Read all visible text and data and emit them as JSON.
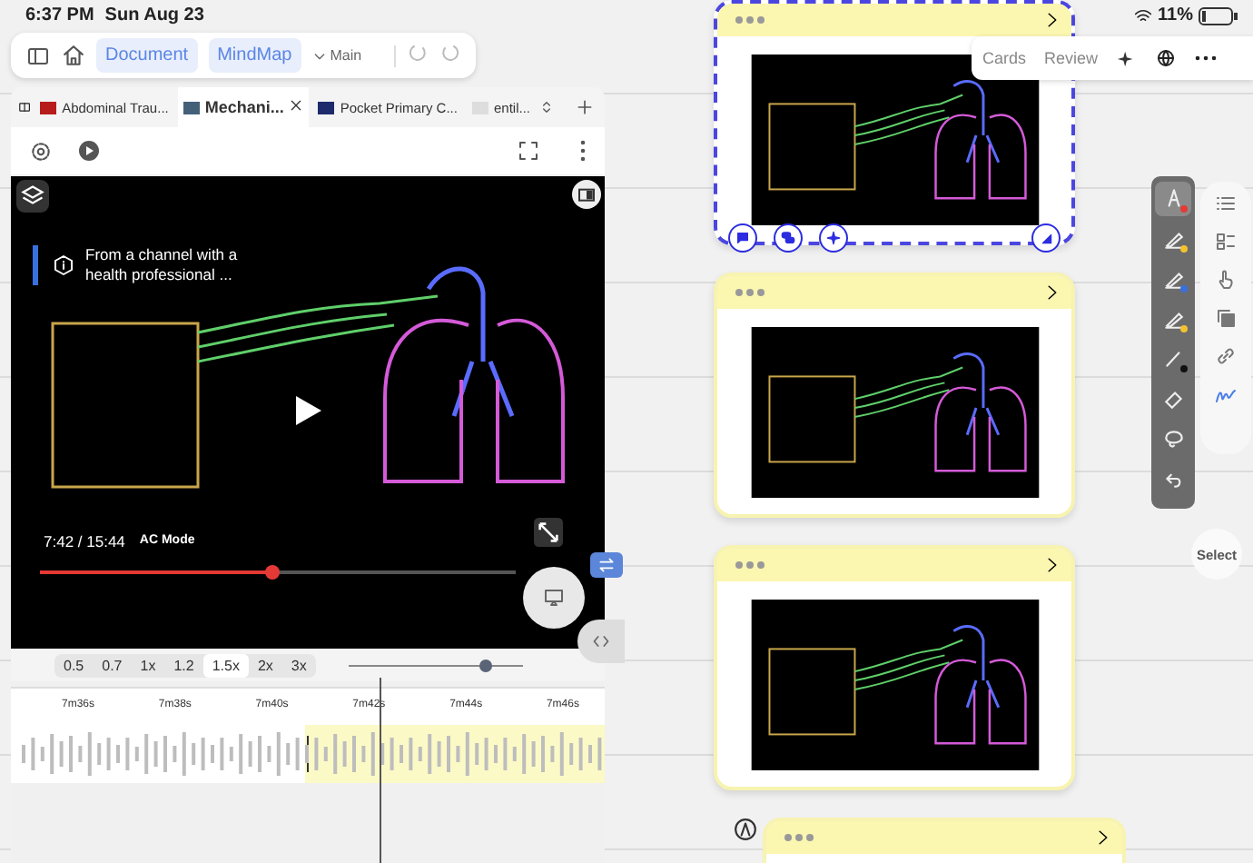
{
  "status_bar": {
    "time": "6:37 PM",
    "date": "Sun Aug 23",
    "battery": "11%"
  },
  "toolbar": {
    "modes": [
      "Document",
      "MindMap"
    ],
    "branch": "Main"
  },
  "browser_tabs": [
    {
      "title": "Abdominal Trau...",
      "selected": false
    },
    {
      "title": "Mechani...",
      "selected": true
    },
    {
      "title": "Pocket Primary C...",
      "selected": false
    },
    {
      "title": "entil...",
      "selected": false
    }
  ],
  "video": {
    "channel_notice": "From a channel with a health professional ...",
    "time": "7:42 / 15:44",
    "chapter": "AC Mode",
    "progress": {
      "level": 0.49
    }
  },
  "speeds": [
    {
      "label": "0.5",
      "selected": false
    },
    {
      "label": "0.7",
      "selected": false
    },
    {
      "label": "1x",
      "selected": false
    },
    {
      "label": "1.2",
      "selected": false
    },
    {
      "label": "1.5x",
      "selected": true
    },
    {
      "label": "2x",
      "selected": false
    },
    {
      "label": "3x",
      "selected": false
    }
  ],
  "zoom_slider": {
    "level": 0.78
  },
  "timeline": {
    "ticks": [
      "7m36s",
      "7m38s",
      "7m40s",
      "7m42s",
      "7m44s",
      "7m46s"
    ]
  },
  "cards": [
    {
      "selected": true
    },
    {
      "selected": false
    },
    {
      "selected": false
    }
  ],
  "review_bar": {
    "tabs": [
      "Cards",
      "Review"
    ]
  },
  "pen_tools": [
    {
      "kind": "pen",
      "color": "#e53935",
      "selected": true
    },
    {
      "kind": "marker",
      "color": "#f2c230",
      "selected": false
    },
    {
      "kind": "marker",
      "color": "#3a6fe0",
      "selected": false
    },
    {
      "kind": "marker",
      "color": "#f2c230",
      "selected": false
    },
    {
      "kind": "line",
      "color": "#111111",
      "selected": false
    },
    {
      "kind": "eraser",
      "selected": false
    },
    {
      "kind": "lasso",
      "selected": false
    },
    {
      "kind": "undo",
      "selected": false
    }
  ],
  "select_button": "Select"
}
